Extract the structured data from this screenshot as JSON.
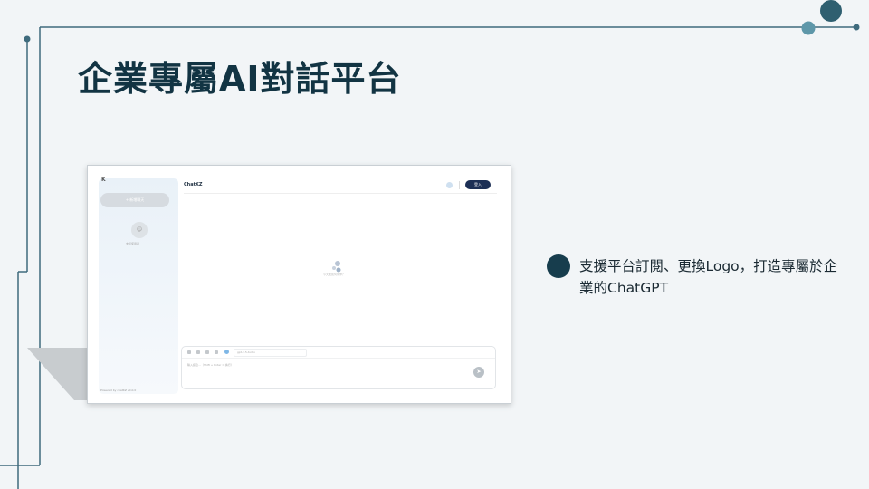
{
  "slide": {
    "title": "企業專屬AI對話平台",
    "bullet_text": "支援平台訂閱、更換Logo，打造專屬於企業的ChatGPT"
  },
  "screenshot": {
    "logo_mark": "K",
    "new_chat_label": "+ 新增聊天",
    "avatar_label": "未知使用者",
    "powered_by": "Powered by chatKZ v0.0.0",
    "chat_title": "ChatKZ",
    "login_label": "登入",
    "empty_state_text": "今天能如何幫你？",
    "model_name": "gpt-3.5-turbo",
    "input_placeholder": "輸入訊息…（Shift + Enter = 換行）"
  },
  "colors": {
    "background": "#f2f5f7",
    "title": "#123443",
    "accent": "#173d4d",
    "lines": "#3f6b7d",
    "dots": "#5e97a9",
    "login_button": "#1c2f55"
  },
  "icons": [
    "user-icon",
    "send-icon",
    "globe-icon",
    "attach-icon",
    "image-icon",
    "code-icon"
  ]
}
